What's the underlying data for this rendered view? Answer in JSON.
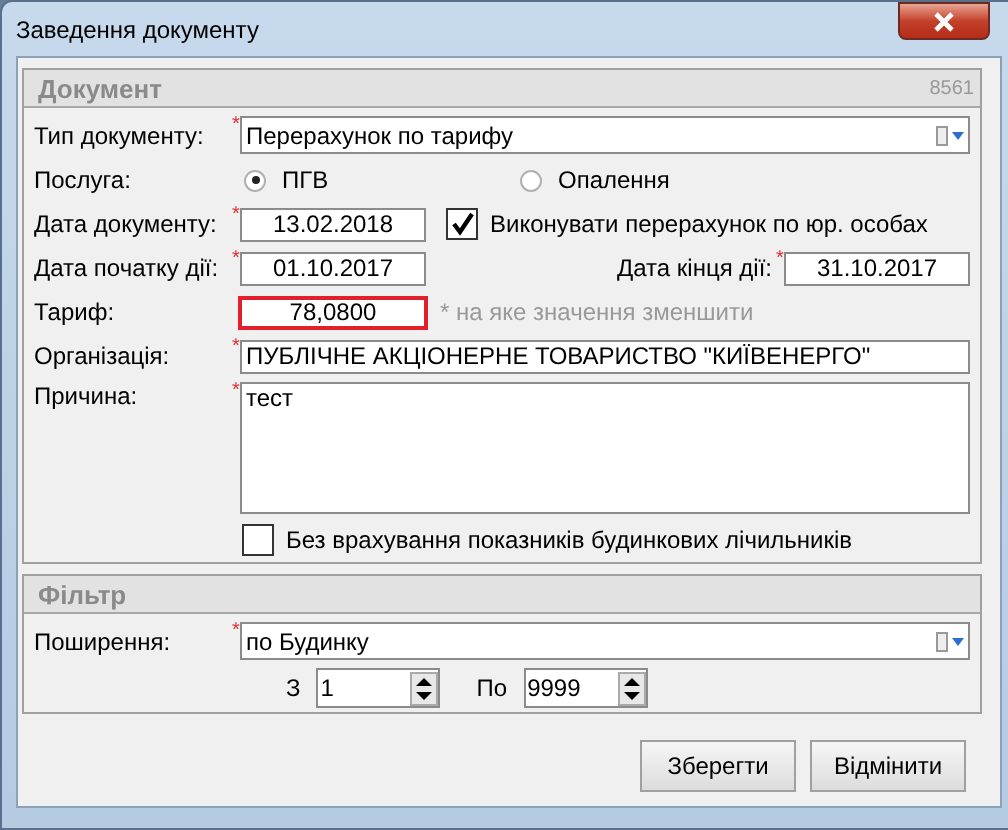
{
  "window": {
    "title": "Заведення документу"
  },
  "document": {
    "title": "Документ",
    "code": "8561",
    "type": {
      "label": "Тип документу:",
      "required_mark": "*",
      "value": "Перерахунок по тарифу"
    },
    "service": {
      "label": "Послуга:",
      "options": [
        {
          "label": "ПГВ",
          "selected": true
        },
        {
          "label": "Опалення",
          "selected": false
        }
      ]
    },
    "doc_date": {
      "label": "Дата документу:",
      "required_mark": "*",
      "value": "13.02.2018"
    },
    "recalc_legal": {
      "label": "Виконувати перерахунок по юр. особах",
      "checked": true
    },
    "start_date": {
      "label": "Дата початку дії:",
      "required_mark": "*",
      "value": "01.10.2017"
    },
    "end_date": {
      "label": "Дата кінця дії:",
      "required_mark": "*",
      "value": "31.10.2017"
    },
    "tariff": {
      "label": "Тариф:",
      "value": "78,0800",
      "highlighted": true,
      "hint": "* на яке значення зменшити"
    },
    "organization": {
      "label": "Організація:",
      "required_mark": "*",
      "value": "ПУБЛІЧНЕ АКЦІОНЕРНЕ ТОВАРИСТВО \"КИЇВЕНЕРГО\""
    },
    "reason": {
      "label": "Причина:",
      "required_mark": "*",
      "value": "тест"
    },
    "ignore_meters": {
      "label": "Без врахування показників будинкових лічильників",
      "checked": false
    }
  },
  "filter": {
    "title": "Фільтр",
    "scope": {
      "label": "Поширення:",
      "required_mark": "*",
      "value": "по Будинку"
    },
    "from": {
      "label": "З",
      "value": "1"
    },
    "to": {
      "label": "По",
      "value": "9999"
    }
  },
  "buttons": [
    "Зберегти",
    "Відмінити"
  ]
}
